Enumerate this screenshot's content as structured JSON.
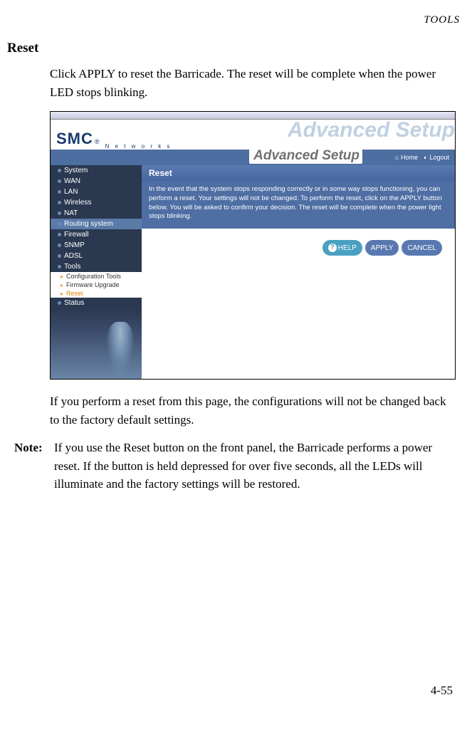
{
  "header": {
    "section_label": "TOOLS"
  },
  "page": {
    "section_title": "Reset",
    "intro_text": "Click APPLY to reset the Barricade. The reset will be complete when the power LED stops blinking.",
    "after_text": "If you perform a reset from this page, the configurations will not be changed back to the factory default settings.",
    "note_label": "Note:",
    "note_text": "If you use the Reset button on the front panel, the Barricade performs a power reset. If the button is held depressed for over five seconds, all the LEDs will illuminate and the factory settings will be restored.",
    "page_number": "4-55"
  },
  "screenshot": {
    "brand": {
      "name": "SMC",
      "reg": "®",
      "sub": "N e t w o r k s"
    },
    "ghost_title": "Advanced Setup",
    "bar_title": "Advanced Setup",
    "topbar": {
      "home": "Home",
      "logout": "Logout"
    },
    "nav": {
      "items": [
        "System",
        "WAN",
        "LAN",
        "Wireless",
        "NAT",
        "Routing system",
        "Firewall",
        "SNMP",
        "ADSL",
        "Tools"
      ],
      "tools_sub": [
        "Configuration Tools",
        "Firmware Upgrade",
        "Reset"
      ],
      "status": "Status"
    },
    "panel": {
      "title": "Reset",
      "body": "In the event that the system stops responding correctly or in some way stops functioning, you can perform a reset. Your settings will not be changed. To perform the reset, click on the APPLY button below. You will be asked to confirm your decision. The reset will be complete when the power light stops blinking."
    },
    "buttons": {
      "help": "HELP",
      "apply": "APPLY",
      "cancel": "CANCEL"
    }
  }
}
